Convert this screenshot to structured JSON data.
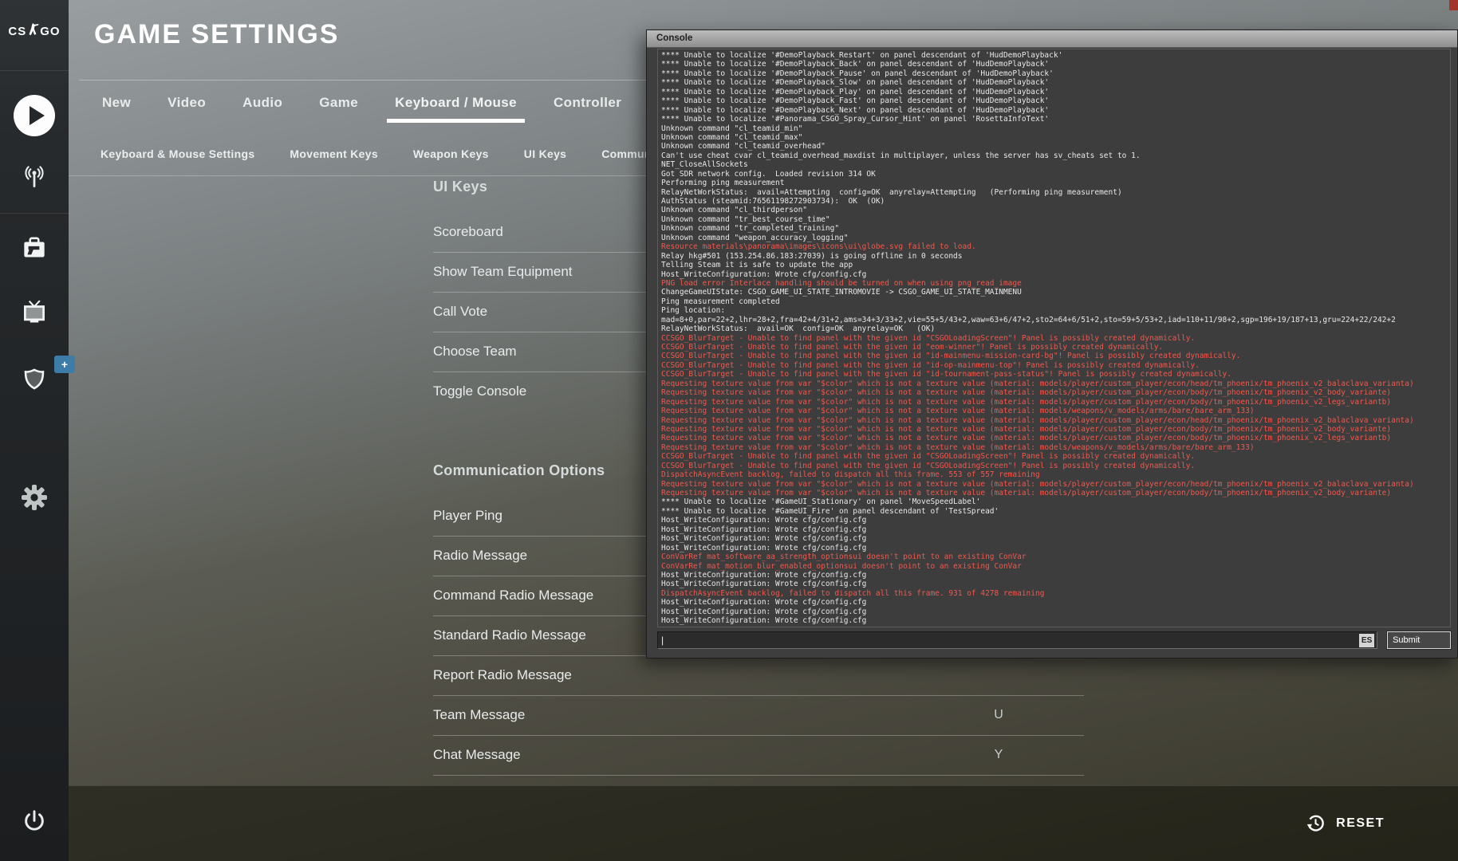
{
  "header": {
    "title": "GAME SETTINGS"
  },
  "logo": {
    "left": "CS",
    "right": "GO"
  },
  "sidebar": {
    "icons": [
      "play",
      "broadcast",
      "inventory",
      "watch",
      "store-shield",
      "settings-gear",
      "power"
    ],
    "store_badge": "+"
  },
  "tabs": {
    "items": [
      "New",
      "Video",
      "Audio",
      "Game",
      "Keyboard / Mouse",
      "Controller"
    ],
    "active_index": 4
  },
  "subtabs": {
    "items": [
      "Keyboard & Mouse Settings",
      "Movement Keys",
      "Weapon Keys",
      "UI Keys",
      "Communication Options"
    ]
  },
  "settings": {
    "sections": [
      {
        "heading": "UI Keys",
        "rows": [
          {
            "label": "Scoreboard",
            "key": ""
          },
          {
            "label": "Show Team Equipment",
            "key": ""
          },
          {
            "label": "Call Vote",
            "key": ""
          },
          {
            "label": "Choose Team",
            "key": ""
          },
          {
            "label": "Toggle Console",
            "key": ""
          }
        ]
      },
      {
        "heading": "Communication Options",
        "rows": [
          {
            "label": "Player Ping",
            "key": ""
          },
          {
            "label": "Radio Message",
            "key": ""
          },
          {
            "label": "Command Radio Message",
            "key": ""
          },
          {
            "label": "Standard Radio Message",
            "key": ""
          },
          {
            "label": "Report Radio Message",
            "key": ""
          },
          {
            "label": "Team Message",
            "key": "U"
          },
          {
            "label": "Chat Message",
            "key": "Y"
          }
        ]
      }
    ]
  },
  "console": {
    "title": "Console",
    "input": {
      "value": "",
      "cursor": "|"
    },
    "lang_button": "ES",
    "submit_label": "Submit",
    "lines": [
      {
        "c": "w",
        "t": "**** Unable to localize '#DemoPlayback_Restart' on panel descendant of 'HudDemoPlayback'"
      },
      {
        "c": "w",
        "t": "**** Unable to localize '#DemoPlayback_Back' on panel descendant of 'HudDemoPlayback'"
      },
      {
        "c": "w",
        "t": "**** Unable to localize '#DemoPlayback_Pause' on panel descendant of 'HudDemoPlayback'"
      },
      {
        "c": "w",
        "t": "**** Unable to localize '#DemoPlayback_Slow' on panel descendant of 'HudDemoPlayback'"
      },
      {
        "c": "w",
        "t": "**** Unable to localize '#DemoPlayback_Play' on panel descendant of 'HudDemoPlayback'"
      },
      {
        "c": "w",
        "t": "**** Unable to localize '#DemoPlayback_Fast' on panel descendant of 'HudDemoPlayback'"
      },
      {
        "c": "w",
        "t": "**** Unable to localize '#DemoPlayback_Next' on panel descendant of 'HudDemoPlayback'"
      },
      {
        "c": "w",
        "t": "**** Unable to localize '#Panorama_CSGO_Spray_Cursor_Hint' on panel 'RosettaInfoText'"
      },
      {
        "c": "w",
        "t": "Unknown command \"cl_teamid_min\""
      },
      {
        "c": "w",
        "t": "Unknown command \"cl_teamid_max\""
      },
      {
        "c": "w",
        "t": "Unknown command \"cl_teamid_overhead\""
      },
      {
        "c": "w",
        "t": "Can't use cheat cvar cl_teamid_overhead_maxdist in multiplayer, unless the server has sv_cheats set to 1."
      },
      {
        "c": "w",
        "t": "NET_CloseAllSockets"
      },
      {
        "c": "w",
        "t": "Got SDR network config.  Loaded revision 314 OK"
      },
      {
        "c": "w",
        "t": "Performing ping measurement"
      },
      {
        "c": "w",
        "t": "RelayNetWorkStatus:  avail=Attempting  config=OK  anyrelay=Attempting   (Performing ping measurement)"
      },
      {
        "c": "w",
        "t": "AuthStatus (steamid:76561198272903734):  OK  (OK)"
      },
      {
        "c": "w",
        "t": "Unknown command \"cl_thirdperson\""
      },
      {
        "c": "w",
        "t": "Unknown command \"tr_best_course_time\""
      },
      {
        "c": "w",
        "t": "Unknown command \"tr_completed_training\""
      },
      {
        "c": "w",
        "t": "Unknown command \"weapon_accuracy_logging\""
      },
      {
        "c": "r",
        "t": "Resource materials\\panorama\\images\\icons\\ui\\globe.svg failed to load."
      },
      {
        "c": "w",
        "t": "Relay hkg#501 (153.254.86.183:27039) is going offline in 0 seconds"
      },
      {
        "c": "w",
        "t": "Telling Steam it is safe to update the app"
      },
      {
        "c": "w",
        "t": "Host_WriteConfiguration: Wrote cfg/config.cfg"
      },
      {
        "c": "r",
        "t": "PNG load error Interlace handling should be turned on when using png_read_image"
      },
      {
        "c": "w",
        "t": "ChangeGameUIState: CSGO_GAME_UI_STATE_INTROMOVIE -> CSGO_GAME_UI_STATE_MAINMENU"
      },
      {
        "c": "w",
        "t": "Ping measurement completed"
      },
      {
        "c": "w",
        "t": "Ping location:"
      },
      {
        "c": "w",
        "t": "mad=8+0,par=22+2,lhr=28+2,fra=42+4/31+2,ams=34+3/33+2,vie=55+5/43+2,waw=63+6/47+2,sto2=64+6/51+2,sto=59+5/53+2,iad=110+11/98+2,sgp=196+19/187+13,gru=224+22/242+2"
      },
      {
        "c": "w",
        "t": "RelayNetWorkStatus:  avail=OK  config=OK  anyrelay=OK   (OK)"
      },
      {
        "c": "r",
        "t": "CCSGO_BlurTarget - Unable to find panel with the given id \"CSGOLoadingScreen\"! Panel is possibly created dynamically."
      },
      {
        "c": "r",
        "t": "CCSGO_BlurTarget - Unable to find panel with the given id \"eom-winner\"! Panel is possibly created dynamically."
      },
      {
        "c": "r",
        "t": "CCSGO_BlurTarget - Unable to find panel with the given id \"id-mainmenu-mission-card-bg\"! Panel is possibly created dynamically."
      },
      {
        "c": "r",
        "t": "CCSGO_BlurTarget - Unable to find panel with the given id \"id-op-mainmenu-top\"! Panel is possibly created dynamically."
      },
      {
        "c": "r",
        "t": "CCSGO_BlurTarget - Unable to find panel with the given id \"id-tournament-pass-status\"! Panel is possibly created dynamically."
      },
      {
        "c": "r",
        "t": "Requesting texture value from var \"$color\" which is not a texture value (material: models/player/custom_player/econ/head/tm_phoenix/tm_phoenix_v2_balaclava_varianta)"
      },
      {
        "c": "r",
        "t": "Requesting texture value from var \"$color\" which is not a texture value (material: models/player/custom_player/econ/body/tm_phoenix/tm_phoenix_v2_body_variante)"
      },
      {
        "c": "r",
        "t": "Requesting texture value from var \"$color\" which is not a texture value (material: models/player/custom_player/econ/body/tm_phoenix/tm_phoenix_v2_legs_variantb)"
      },
      {
        "c": "r",
        "t": "Requesting texture value from var \"$color\" which is not a texture value (material: models/weapons/v_models/arms/bare/bare_arm_133)"
      },
      {
        "c": "r",
        "t": "Requesting texture value from var \"$color\" which is not a texture value (material: models/player/custom_player/econ/head/tm_phoenix/tm_phoenix_v2_balaclava_varianta)"
      },
      {
        "c": "r",
        "t": "Requesting texture value from var \"$color\" which is not a texture value (material: models/player/custom_player/econ/body/tm_phoenix/tm_phoenix_v2_body_variante)"
      },
      {
        "c": "r",
        "t": "Requesting texture value from var \"$color\" which is not a texture value (material: models/player/custom_player/econ/body/tm_phoenix/tm_phoenix_v2_legs_variantb)"
      },
      {
        "c": "r",
        "t": "Requesting texture value from var \"$color\" which is not a texture value (material: models/weapons/v_models/arms/bare/bare_arm_133)"
      },
      {
        "c": "r",
        "t": "CCSGO_BlurTarget - Unable to find panel with the given id \"CSGOLoadingScreen\"! Panel is possibly created dynamically."
      },
      {
        "c": "r",
        "t": "CCSGO_BlurTarget - Unable to find panel with the given id \"CSGOLoadingScreen\"! Panel is possibly created dynamically."
      },
      {
        "c": "r",
        "t": "DispatchAsyncEvent backlog, failed to dispatch all this frame. 553 of 557 remaining"
      },
      {
        "c": "r",
        "t": "Requesting texture value from var \"$color\" which is not a texture value (material: models/player/custom_player/econ/head/tm_phoenix/tm_phoenix_v2_balaclava_varianta)"
      },
      {
        "c": "r",
        "t": "Requesting texture value from var \"$color\" which is not a texture value (material: models/player/custom_player/econ/body/tm_phoenix/tm_phoenix_v2_body_variante)"
      },
      {
        "c": "w",
        "t": "**** Unable to localize '#GameUI_Stationary' on panel 'MoveSpeedLabel'"
      },
      {
        "c": "w",
        "t": "**** Unable to localize '#GameUI_Fire' on panel descendant of 'TestSpread'"
      },
      {
        "c": "w",
        "t": "Host_WriteConfiguration: Wrote cfg/config.cfg"
      },
      {
        "c": "w",
        "t": "Host_WriteConfiguration: Wrote cfg/config.cfg"
      },
      {
        "c": "w",
        "t": "Host_WriteConfiguration: Wrote cfg/config.cfg"
      },
      {
        "c": "w",
        "t": "Host_WriteConfiguration: Wrote cfg/config.cfg"
      },
      {
        "c": "r",
        "t": "ConVarRef mat_software_aa_strength_optionsui doesn't point to an existing ConVar"
      },
      {
        "c": "r",
        "t": "ConVarRef mat_motion_blur_enabled_optionsui doesn't point to an existing ConVar"
      },
      {
        "c": "w",
        "t": "Host_WriteConfiguration: Wrote cfg/config.cfg"
      },
      {
        "c": "w",
        "t": "Host_WriteConfiguration: Wrote cfg/config.cfg"
      },
      {
        "c": "r",
        "t": "DispatchAsyncEvent backlog, failed to dispatch all this frame. 931 of 4278 remaining"
      },
      {
        "c": "w",
        "t": "Host_WriteConfiguration: Wrote cfg/config.cfg"
      },
      {
        "c": "w",
        "t": "Host_WriteConfiguration: Wrote cfg/config.cfg"
      },
      {
        "c": "w",
        "t": "Host_WriteConfiguration: Wrote cfg/config.cfg"
      }
    ]
  },
  "footer": {
    "reset_label": "RESET"
  },
  "colors": {
    "error_red": "#f0584d",
    "badge_blue": "#3e7ca8",
    "active_underline": "#ffffff"
  }
}
